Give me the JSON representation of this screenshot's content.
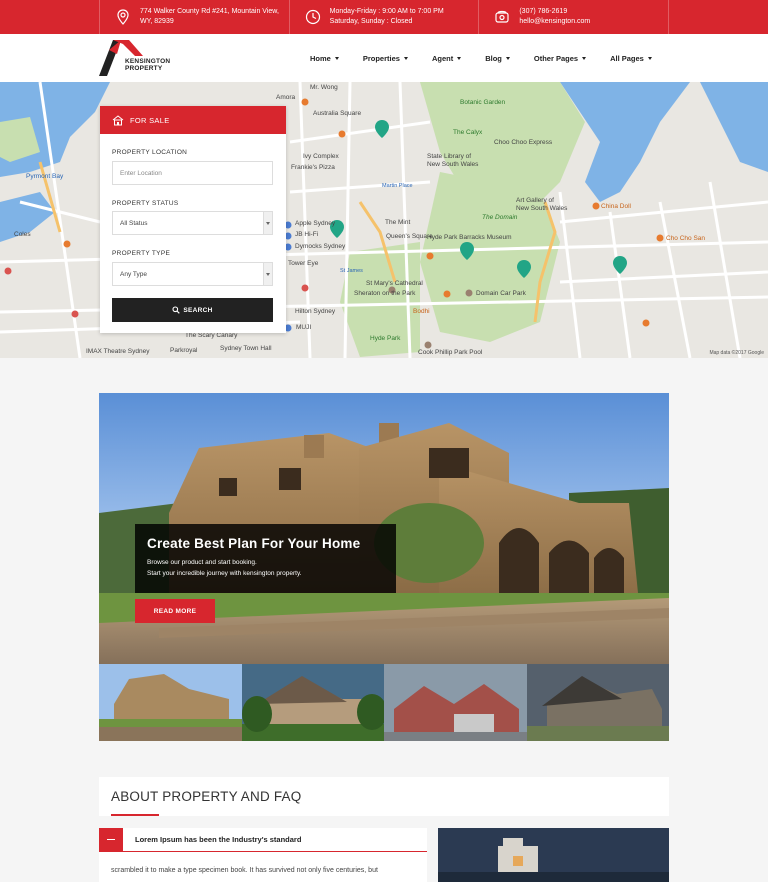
{
  "topbar": {
    "address_line1": "774 Walker County Rd #241, Mountain View,",
    "address_line2": "WY, 82939",
    "hours_line1": "Monday-Friday : 9:00 AM to 7:00 PM",
    "hours_line2": "Saturday, Sunday : Closed",
    "phone": "(307) 786-2619",
    "email": "hello@kensington.com"
  },
  "brand": {
    "line1": "KENSINGTON",
    "line2": "PROPERTY"
  },
  "nav": {
    "items": [
      "Home",
      "Properties",
      "Agent",
      "Blog",
      "Other Pages",
      "All Pages"
    ]
  },
  "map": {
    "labels": [
      "Mr. Wong",
      "Amora",
      "Australia Square",
      "Botanic Garden",
      "The Calyx",
      "Choo Choo Express",
      "State Library of",
      "New South Wales",
      "Ivy Complex",
      "Frankie's Pizza",
      "Pyrmont Bay",
      "Coles",
      "Apple Sydney",
      "JB Hi-Fi",
      "Dymocks Sydney",
      "Tower Eye",
      "Hilton Sydney",
      "MUJI",
      "The Mint",
      "Queen's Square",
      "Hyde Park Barracks Museum",
      "Art Gallery of",
      "New South Wales",
      "China Doll",
      "Cho Cho San",
      "St Mary's Cathedral",
      "Sheraton on the Park",
      "Domain Car Park",
      "Bodhi",
      "Hyde Park",
      "IMAX Theatre Sydney",
      "Parkroyal",
      "Sydney Town Hall",
      "The Scary Canary",
      "Cook Phillip Park Pool",
      "The Domain",
      "Martin Place",
      "St James"
    ],
    "credit": "Map data ©2017 Google"
  },
  "search": {
    "header": "FOR SALE",
    "location_label": "PROPERTY LOCATION",
    "location_placeholder": "Enter Location",
    "status_label": "PROPERTY STATUS",
    "status_value": "All Status",
    "type_label": "PROPERTY TYPE",
    "type_value": "Any Type",
    "button": "SEARCH"
  },
  "hero": {
    "title": "Create Best Plan For Your Home",
    "sub1": "Browse our product and start booking.",
    "sub2": "Start your incredible journey with kensington property.",
    "button": "READ MORE"
  },
  "about": {
    "title": "ABOUT PROPERTY AND FAQ",
    "faq_title": "Lorem Ipsum has been the Industry's standard",
    "faq_body": "scrambled it to make a type specimen book. It has survived not only five centuries, but"
  },
  "colors": {
    "accent": "#d7262e",
    "dark": "#222222"
  }
}
